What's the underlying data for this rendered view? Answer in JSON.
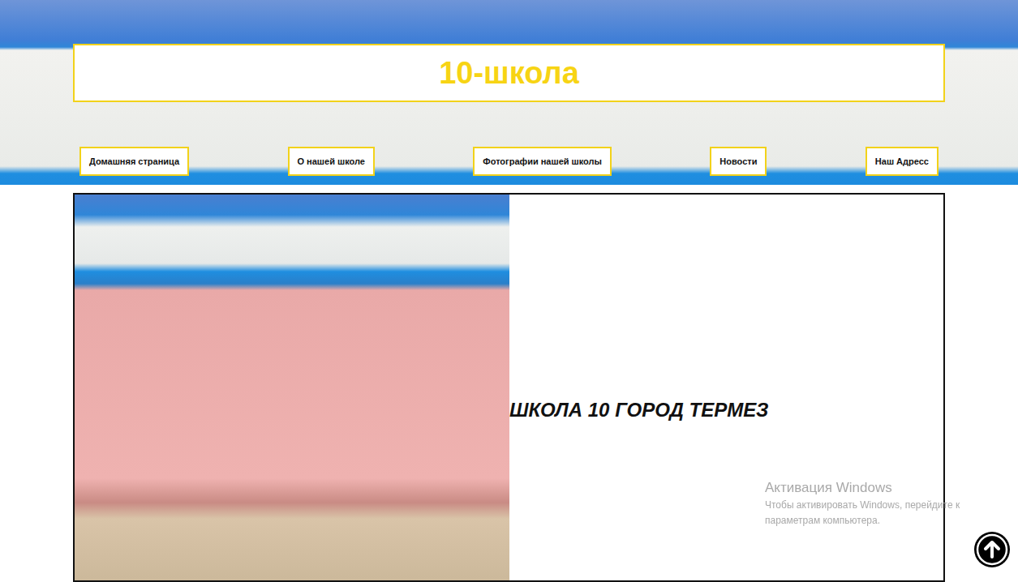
{
  "header": {
    "title": "10-школа"
  },
  "nav": [
    {
      "label": "Домашняя страница"
    },
    {
      "label": "О нашей школе"
    },
    {
      "label": "Фотографии нашей школы"
    },
    {
      "label": "Новости"
    },
    {
      "label": "Наш Адресс"
    }
  ],
  "hero": {
    "caption": "ШКОЛА 10 ГОРОД ТЕРМЕЗ"
  },
  "watermark": {
    "title": "Активация Windows",
    "text": "Чтобы активировать Windows, перейдите к параметрам компьютера."
  }
}
